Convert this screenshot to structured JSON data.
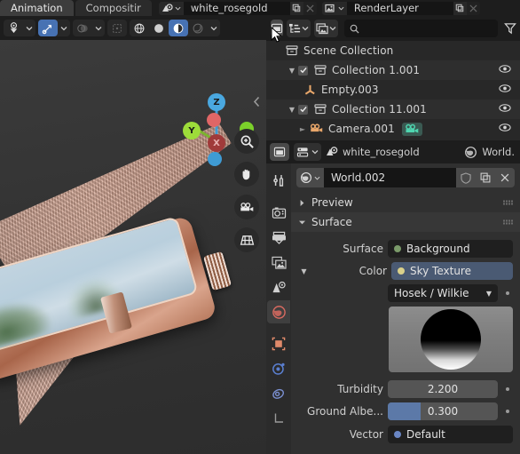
{
  "topbar": {
    "workspace_tabs": [
      {
        "label": "Animation",
        "active": true
      },
      {
        "label": "Compositir",
        "active": false
      }
    ],
    "scene_name": "white_rosegold",
    "view_layer_name": "RenderLayer",
    "scene_icon": "scene-icon",
    "view_layer_icon": "renderlayers-icon",
    "new_scene_icon": "duplicate-icon",
    "remove_scene_icon": "close-x-icon"
  },
  "viewport": {
    "header": {
      "visibility_icon": "object-visibility-icon",
      "gizmo_icon": "gizmo-icon",
      "overlays_icon": "overlays-icon",
      "xray_icon": "xray-toggle-icon",
      "shading_wireframe": "shading-wireframe-icon",
      "shading_solid": "shading-solid-icon",
      "shading_material": "shading-material-preview-icon",
      "shading_rendered": "shading-rendered-icon",
      "dropdown_caret": "chevron-down-icon"
    },
    "gizmo": {
      "axes": [
        {
          "label": "X",
          "color": "#a03a3a",
          "neg_color": "#e06666"
        },
        {
          "label": "Y",
          "color": "#7bb32e",
          "neg_color": "#9ddc3a"
        },
        {
          "label": "Z",
          "color": "#3f9bd4",
          "neg_color": "#4aa8e0"
        }
      ]
    },
    "nav_buttons": [
      {
        "name": "zoom-icon",
        "glyph": "zoom"
      },
      {
        "name": "pan-hand-icon",
        "glyph": "hand"
      },
      {
        "name": "camera-view-icon",
        "glyph": "camera"
      },
      {
        "name": "toggle-perspective-icon",
        "glyph": "grid"
      }
    ],
    "sidebar_toggle": "chevron-left-icon"
  },
  "outliner": {
    "header": {
      "editor_type_icon": "editor-type-outliner-icon",
      "display_mode_icon": "outliner-display-mode-icon",
      "filter_id_icon": "filter-id-type-icon",
      "search_icon": "search-icon",
      "search_value": "",
      "search_placeholder": "",
      "filter_icon": "filter-funnel-icon"
    },
    "rows": [
      {
        "label": "Scene Collection",
        "icon": "collection-icon",
        "indent": 0,
        "expander": "",
        "checkbox": false,
        "eye": false,
        "alt": false
      },
      {
        "label": "Collection 1.001",
        "icon": "collection-icon",
        "indent": 1,
        "expander": "down",
        "checkbox": true,
        "eye": true,
        "alt": true
      },
      {
        "label": "Empty.003",
        "icon": "empty-axes-icon",
        "indent": 2,
        "expander": "",
        "checkbox": false,
        "eye": true,
        "alt": false
      },
      {
        "label": "Collection 11.001",
        "icon": "collection-icon",
        "indent": 1,
        "expander": "down",
        "checkbox": true,
        "eye": true,
        "alt": true
      },
      {
        "label": "Camera.001",
        "icon": "camera-object-icon",
        "indent": 2,
        "expander": "right",
        "checkbox": false,
        "eye": true,
        "alt": false,
        "data_icon": "camera-data-icon"
      }
    ]
  },
  "properties": {
    "header": {
      "editor_type_icon": "editor-type-properties-icon",
      "display_filter_icon": "properties-filter-icon",
      "breadcrumb_scene_icon": "scene-icon",
      "breadcrumb_scene": "white_rosegold",
      "breadcrumb_world_icon": "world-icon",
      "breadcrumb_world": "World."
    },
    "tabs": [
      {
        "name": "tool-tab",
        "icon": "tool-wrench-icon",
        "active": false
      },
      {
        "name": "render-tab",
        "icon": "render-camera-back-icon",
        "active": false
      },
      {
        "name": "output-tab",
        "icon": "output-printer-icon",
        "active": false
      },
      {
        "name": "view-layer-tab",
        "icon": "view-layer-images-icon",
        "active": false
      },
      {
        "name": "scene-tab",
        "icon": "scene-cone-icon",
        "active": false
      },
      {
        "name": "world-tab",
        "icon": "world-globe-icon",
        "active": true
      },
      {
        "name": "object-tab",
        "icon": "object-square-icon",
        "active": false
      },
      {
        "name": "modifier-tab",
        "icon": "physics-orbit-icon",
        "active": false
      },
      {
        "name": "constraints-tab",
        "icon": "constraints-icon",
        "active": false
      },
      {
        "name": "object-data-tab",
        "icon": "object-data-axes-icon",
        "active": false
      }
    ],
    "id_block": {
      "browse_icon": "browse-world-icon",
      "name": "World.002",
      "shield_icon": "fake-user-shield-icon",
      "copy_icon": "new-world-copy-icon",
      "close_icon": "unlink-x-icon"
    },
    "panels": [
      {
        "name": "preview-panel",
        "title": "Preview",
        "expanded": false
      },
      {
        "name": "surface-panel",
        "title": "Surface",
        "expanded": true
      }
    ],
    "fields": [
      {
        "name": "surface-shader",
        "label": "Surface",
        "value": "Background",
        "style": "dark",
        "dot_color": "#7a9a6a",
        "has_expander": false,
        "has_decorator": false
      },
      {
        "name": "color-input",
        "label": "Color",
        "value": "Sky Texture",
        "style": "blue",
        "dot_color": "#d9d08a",
        "has_expander": true,
        "expander": "down",
        "has_decorator": false
      },
      {
        "name": "sky-type-dropdown",
        "label": "",
        "value": "Hosek / Wilkie",
        "style": "dark",
        "is_dropdown": true,
        "has_decorator": true
      },
      {
        "name": "turbidity-slider",
        "label": "Turbidity",
        "value": "2.200",
        "style": "plain",
        "fill_percent": 0,
        "has_decorator": true
      },
      {
        "name": "ground-albedo-slider",
        "label": "Ground Albe...",
        "value": "0.300",
        "style": "plain",
        "fill_percent": 30,
        "has_decorator": true
      },
      {
        "name": "vector-input",
        "label": "Vector",
        "value": "Default",
        "style": "dark",
        "dot_color": "#6a86c4",
        "has_decorator": false
      }
    ],
    "sun_preview": {
      "name": "sky-preview",
      "has_decorator": true
    }
  }
}
